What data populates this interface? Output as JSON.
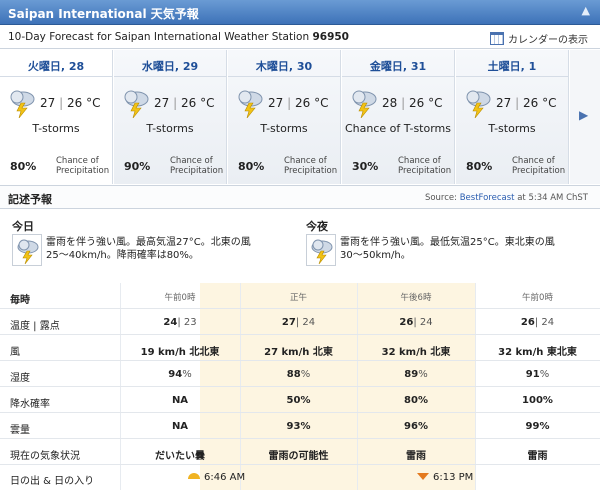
{
  "window": {
    "title": "Saipan International 天気予報",
    "collapse_glyph": "▲"
  },
  "subheader": {
    "prefix": "10-Day Forecast for Saipan International Weather Station",
    "station_id": "96950",
    "calendar_label": "カレンダーの表示"
  },
  "days": [
    {
      "name": "火曜日, 28",
      "high": "27",
      "low": "26",
      "unit": "°C",
      "condition": "T-storms",
      "precip": "80%",
      "icon": "thunderstorm-icon"
    },
    {
      "name": "水曜日, 29",
      "high": "27",
      "low": "26",
      "unit": "°C",
      "condition": "T-storms",
      "precip": "90%",
      "icon": "thunderstorm-icon"
    },
    {
      "name": "木曜日, 30",
      "high": "27",
      "low": "26",
      "unit": "°C",
      "condition": "T-storms",
      "precip": "80%",
      "icon": "thunderstorm-icon"
    },
    {
      "name": "金曜日, 31",
      "high": "28",
      "low": "26",
      "unit": "°C",
      "condition": "Chance of T-storms",
      "precip": "30%",
      "icon": "thunderstorm-icon"
    },
    {
      "name": "土曜日, 1",
      "high": "27",
      "low": "26",
      "unit": "°C",
      "condition": "T-storms",
      "precip": "80%",
      "icon": "thunderstorm-icon"
    }
  ],
  "precip_label_1": "Chance of",
  "precip_label_2": "Precipitation",
  "next_arrow": "▶",
  "description": {
    "heading": "記述予報",
    "source_prefix": "Source:",
    "source_link": "BestForecast",
    "source_suffix": "at 5:34 AM ChST",
    "today": {
      "title": "今日",
      "line1": "雷雨を伴う強い風。最高気温27°C。北東の風",
      "line2": "25〜40km/h。降雨確率は80%。"
    },
    "tonight": {
      "title": "今夜",
      "line1": "雷雨を伴う強い風。最低気温25°C。東北東の風",
      "line2": "30〜50km/h。"
    }
  },
  "hourly": {
    "header_label": "毎時",
    "times": [
      "午前0時",
      "正午",
      "午後6時",
      "午前0時"
    ],
    "rows": [
      {
        "label": "温度 | 露点",
        "values": [
          [
            "24",
            "| 23"
          ],
          [
            "27",
            "| 24"
          ],
          [
            "26",
            "| 24"
          ],
          [
            "26",
            "| 24"
          ]
        ]
      },
      {
        "label": "風",
        "values": [
          [
            "19 km/h 北北東",
            ""
          ],
          [
            "27 km/h 北東",
            ""
          ],
          [
            "32 km/h 北東",
            ""
          ],
          [
            "32 km/h 東北東",
            ""
          ]
        ]
      },
      {
        "label": "湿度",
        "values": [
          [
            "94",
            "%"
          ],
          [
            "88",
            "%"
          ],
          [
            "89",
            "%"
          ],
          [
            "91",
            "%"
          ]
        ]
      },
      {
        "label": "降水確率",
        "values": [
          [
            "NA",
            ""
          ],
          [
            "50%",
            ""
          ],
          [
            "80%",
            ""
          ],
          [
            "100%",
            ""
          ]
        ]
      },
      {
        "label": "雲量",
        "values": [
          [
            "NA",
            ""
          ],
          [
            "93%",
            ""
          ],
          [
            "96%",
            ""
          ],
          [
            "99%",
            ""
          ]
        ]
      },
      {
        "label": "現在の気象状況",
        "values": [
          [
            "だいたい曇",
            ""
          ],
          [
            "雷雨の可能性",
            ""
          ],
          [
            "雷雨",
            ""
          ],
          [
            "雷雨",
            ""
          ]
        ]
      }
    ],
    "sun_label": "日の出 & 日の入り",
    "sunrise": "6:46 AM",
    "sunset": "6:13 PM"
  }
}
